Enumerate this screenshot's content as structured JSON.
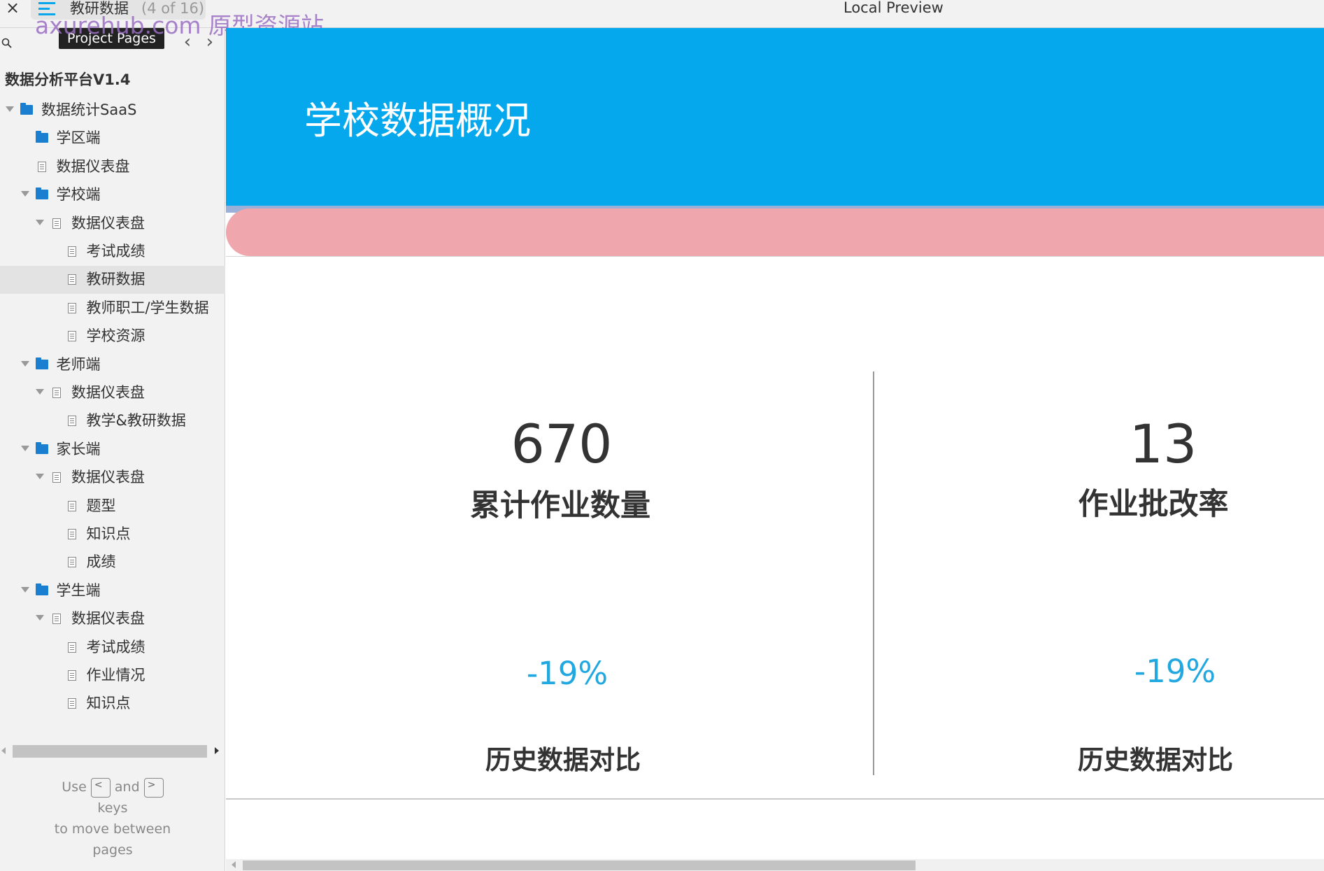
{
  "topbar": {
    "current_page": "教研数据",
    "page_count": "(4 of 16)",
    "watermark": "axurehub.com 原型资源站",
    "preview_title": "Local Preview"
  },
  "sidebar": {
    "tooltip": "Project Pages",
    "project_name": "数据分析平台V1.4",
    "tree": [
      {
        "label": "数据统计SaaS",
        "type": "folder",
        "depth": 0,
        "expanded": true
      },
      {
        "label": "学区端",
        "type": "folder",
        "depth": 1,
        "expanded": false
      },
      {
        "label": "数据仪表盘",
        "type": "page",
        "depth": 1,
        "expanded": false
      },
      {
        "label": "学校端",
        "type": "folder",
        "depth": 1,
        "expanded": true
      },
      {
        "label": "数据仪表盘",
        "type": "page",
        "depth": 2,
        "expanded": true
      },
      {
        "label": "考试成绩",
        "type": "page",
        "depth": 3,
        "expanded": false
      },
      {
        "label": "教研数据",
        "type": "page",
        "depth": 3,
        "expanded": false,
        "selected": true
      },
      {
        "label": "教师职工/学生数据",
        "type": "page",
        "depth": 3,
        "expanded": false
      },
      {
        "label": "学校资源",
        "type": "page",
        "depth": 3,
        "expanded": false
      },
      {
        "label": "老师端",
        "type": "folder",
        "depth": 1,
        "expanded": true
      },
      {
        "label": "数据仪表盘",
        "type": "page",
        "depth": 2,
        "expanded": true
      },
      {
        "label": "教学&教研数据",
        "type": "page",
        "depth": 3,
        "expanded": false
      },
      {
        "label": "家长端",
        "type": "folder",
        "depth": 1,
        "expanded": true
      },
      {
        "label": "数据仪表盘",
        "type": "page",
        "depth": 2,
        "expanded": true
      },
      {
        "label": "题型",
        "type": "page",
        "depth": 3,
        "expanded": false
      },
      {
        "label": "知识点",
        "type": "page",
        "depth": 3,
        "expanded": false
      },
      {
        "label": "成绩",
        "type": "page",
        "depth": 3,
        "expanded": false
      },
      {
        "label": "学生端",
        "type": "folder",
        "depth": 1,
        "expanded": true
      },
      {
        "label": "数据仪表盘",
        "type": "page",
        "depth": 2,
        "expanded": true
      },
      {
        "label": "考试成绩",
        "type": "page",
        "depth": 3,
        "expanded": false
      },
      {
        "label": "作业情况",
        "type": "page",
        "depth": 3,
        "expanded": false
      },
      {
        "label": "知识点",
        "type": "page",
        "depth": 3,
        "expanded": false
      }
    ],
    "help": {
      "use": "Use",
      "prev_key": "<",
      "and": "and",
      "next_key": ">",
      "keys": "keys",
      "line2": "to move between",
      "line3": "pages"
    }
  },
  "main": {
    "banner_title": "学校数据概况",
    "colors": {
      "banner": "#05a7ed",
      "accent_bar": "#f0a6ad",
      "change": "#22a8e0"
    },
    "stats": [
      {
        "value": "670",
        "label": "累计作业数量",
        "change": "-19%",
        "compare_label": "历史数据对比"
      },
      {
        "value": "13",
        "label": "作业批改率",
        "change": "-19%",
        "compare_label": "历史数据对比"
      }
    ]
  }
}
